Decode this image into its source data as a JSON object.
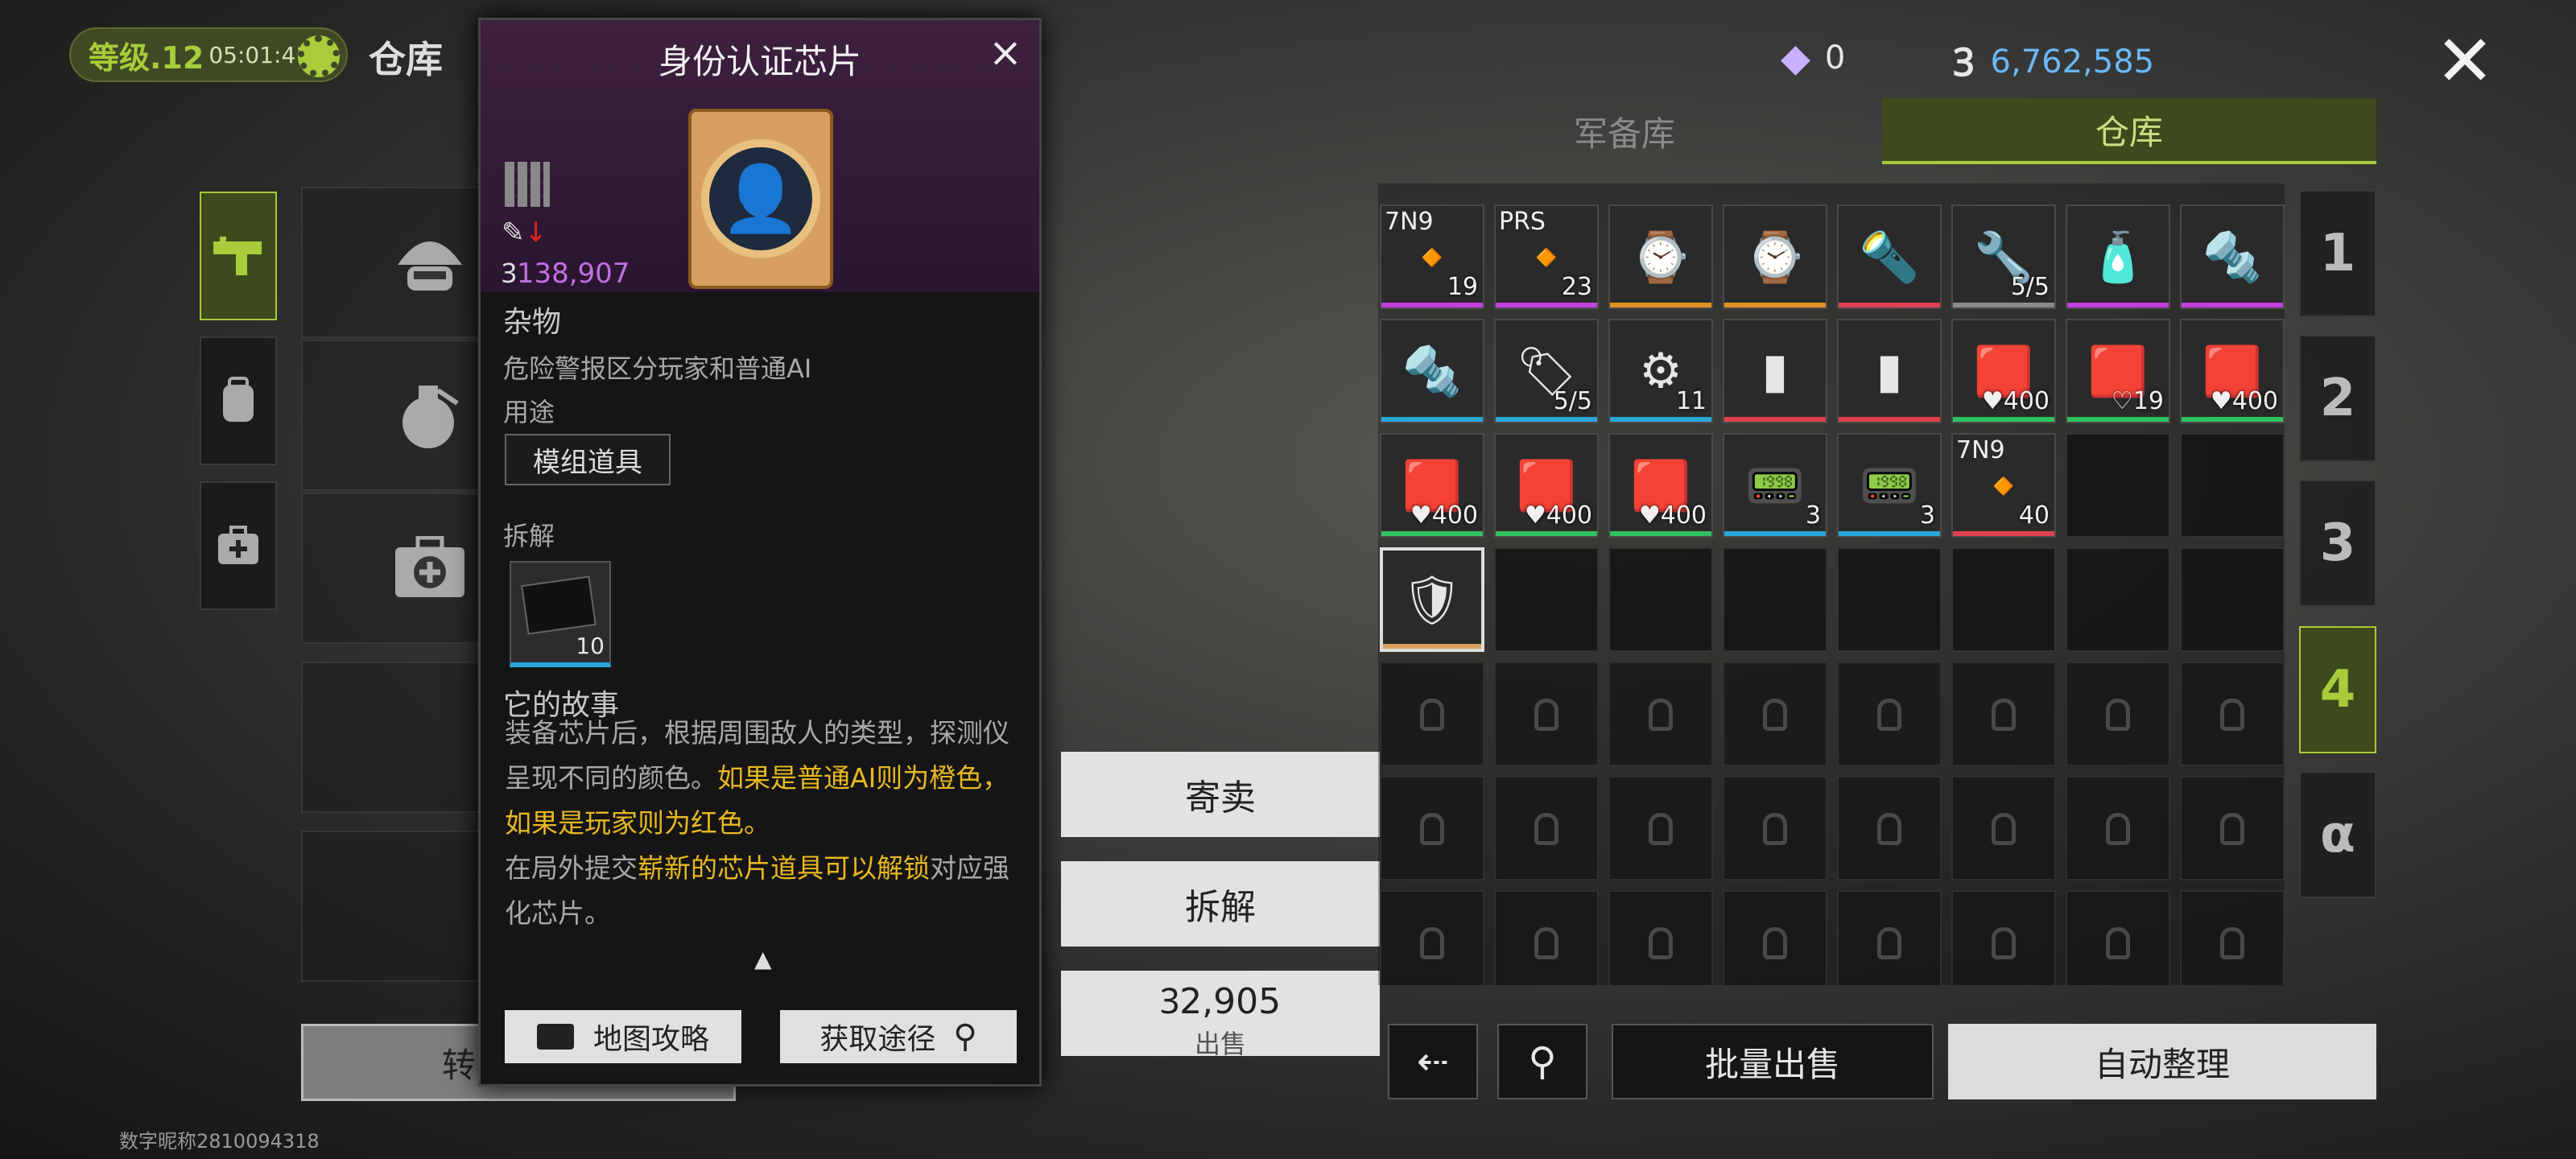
{
  "header": {
    "level": "等级.12",
    "timer": "05:01:41",
    "title": "仓库",
    "gems": "0",
    "money": "6,762,585"
  },
  "nickname": "数字昵称2810094318",
  "left": {
    "transfer_label": "转"
  },
  "detail": {
    "title": "身份认证芯片",
    "price": "138,907",
    "category": "杂物",
    "desc": "危险警报区分玩家和普通AI",
    "usage_label": "用途",
    "usage_tag": "模组道具",
    "disassemble_label": "拆解",
    "disassemble_count": "10",
    "story_title": "它的故事",
    "story_1": "装备芯片后，根据周围敌人的类型，探测仪呈现不同的颜色。",
    "story_2": "如果是普通AI则为橙色，如果是玩家则为红色。",
    "story_3a": "在局外提交",
    "story_3b": "崭新的芯片道具可以解锁",
    "story_3c": "对应强化芯片。",
    "map_btn": "地图攻略",
    "source_btn": "获取途径"
  },
  "actions": {
    "consign": "寄卖",
    "disassemble": "拆解",
    "sell_price": "2,905",
    "sell_label": "出售"
  },
  "tabs": {
    "armory": "军备库",
    "warehouse": "仓库"
  },
  "pages": [
    "1",
    "2",
    "3",
    "4",
    "α"
  ],
  "active_page": "4",
  "grid_rows": [
    [
      {
        "l": "7N9",
        "c": "19",
        "bar": "#c040e0",
        "ico": "🔸"
      },
      {
        "l": "PRS",
        "c": "23",
        "bar": "#c040e0",
        "ico": "🔸"
      },
      {
        "l": "",
        "c": "",
        "bar": "#e09020",
        "ico": "⌚"
      },
      {
        "l": "",
        "c": "",
        "bar": "#e09020",
        "ico": "⌚"
      },
      {
        "l": "",
        "c": "",
        "bar": "#e04050",
        "ico": "🔦"
      },
      {
        "l": "",
        "c": "5/5",
        "bar": "#8a8a8a",
        "ico": "🔧"
      },
      {
        "l": "",
        "c": "",
        "bar": "#c040e0",
        "ico": "🧴"
      },
      {
        "l": "",
        "c": "",
        "bar": "#c040e0",
        "ico": "🔩"
      }
    ],
    [
      {
        "l": "",
        "c": "",
        "bar": "#29a6d8",
        "ico": "🔩"
      },
      {
        "l": "",
        "c": "5/5",
        "bar": "#29a6d8",
        "ico": "🏷"
      },
      {
        "l": "",
        "c": "11",
        "bar": "#29a6d8",
        "ico": "⚙"
      },
      {
        "l": "",
        "c": "",
        "bar": "#e04050",
        "ico": "▮"
      },
      {
        "l": "",
        "c": "",
        "bar": "#e04050",
        "ico": "▮"
      },
      {
        "l": "",
        "c": "♥400",
        "bar": "#30c060",
        "ico": "🟥"
      },
      {
        "l": "",
        "c": "♡19",
        "bar": "#30c060",
        "ico": "🟥"
      },
      {
        "l": "",
        "c": "♥400",
        "bar": "#30c060",
        "ico": "🟥"
      }
    ],
    [
      {
        "l": "",
        "c": "♥400",
        "bar": "#30c060",
        "ico": "🟥"
      },
      {
        "l": "",
        "c": "♥400",
        "bar": "#30c060",
        "ico": "🟥"
      },
      {
        "l": "",
        "c": "♥400",
        "bar": "#30c060",
        "ico": "🟥"
      },
      {
        "l": "",
        "c": "3",
        "bar": "#29a6d8",
        "ico": "📟"
      },
      {
        "l": "",
        "c": "3",
        "bar": "#29a6d8",
        "ico": "📟"
      },
      {
        "l": "7N9",
        "c": "40",
        "bar": "#e04050",
        "ico": "🔸"
      }
    ],
    [
      {
        "l": "",
        "c": "",
        "bar": "#d8a060",
        "ico": "🛡",
        "sel": true
      }
    ]
  ],
  "bottom": {
    "batch_sell": "批量出售",
    "auto_sort": "自动整理"
  },
  "colors": {
    "accent": "#a8cc3a",
    "money": "#6ab8f8",
    "price_purple": "#c070e0",
    "highlight": "#e8b820"
  }
}
